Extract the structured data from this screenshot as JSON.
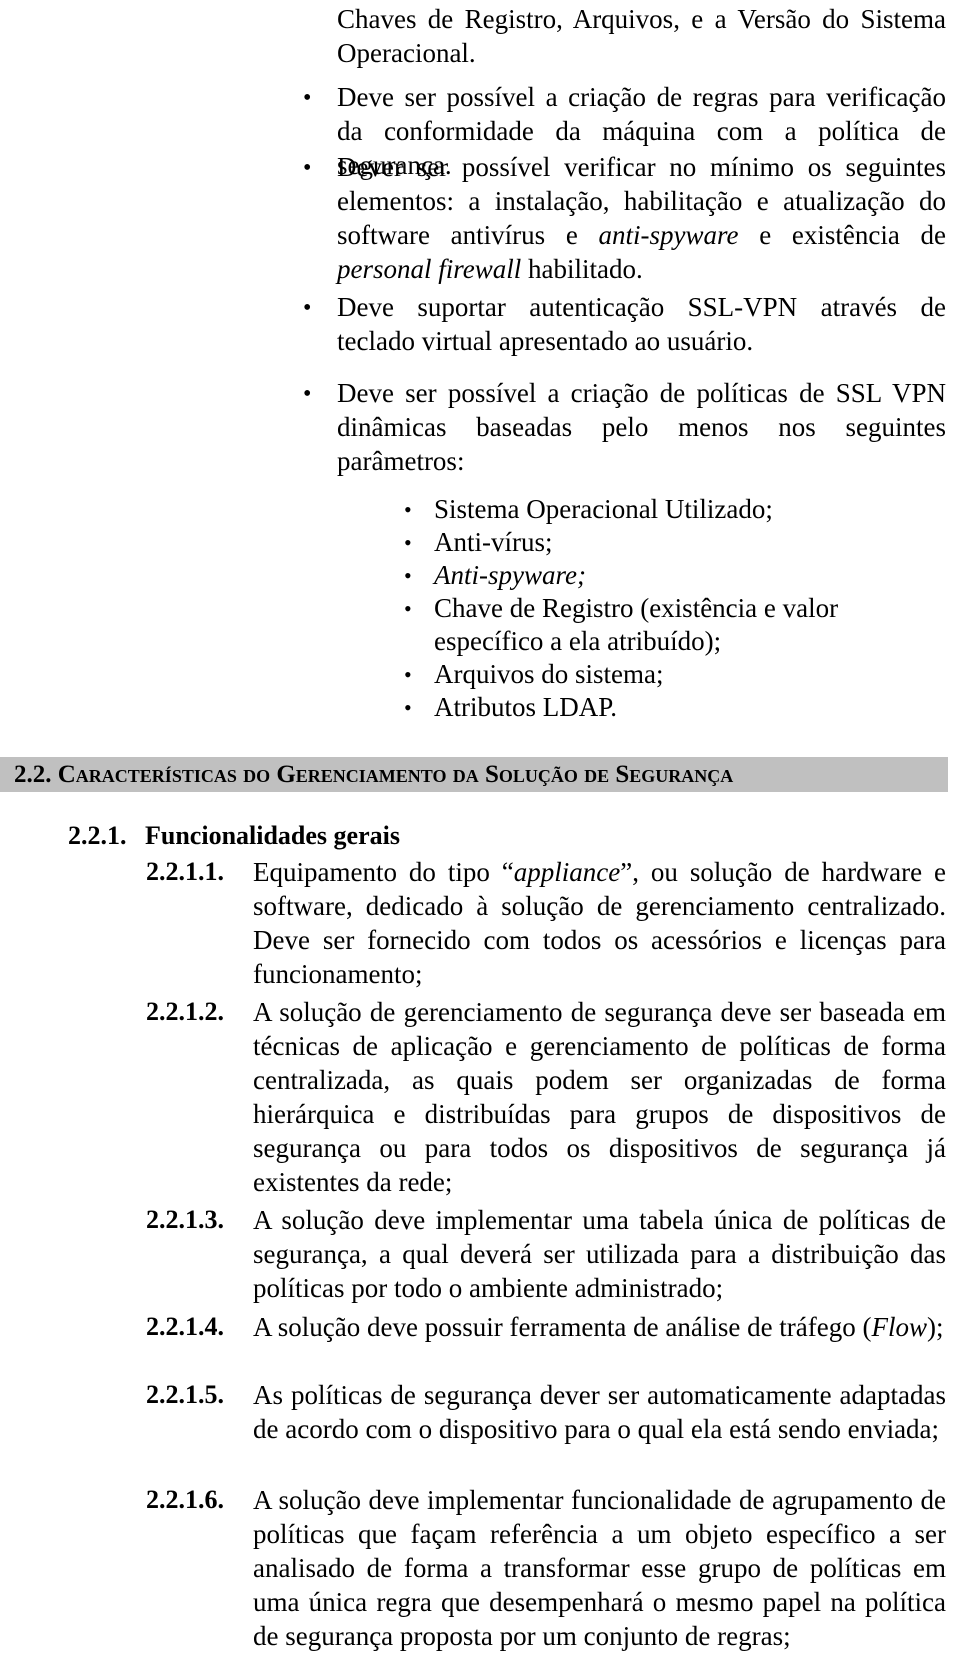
{
  "document": {
    "language": "pt-BR",
    "continuation_paragraph": {
      "text": "Chaves de Registro, Arquivos, e a Versão do Sistema Operacional."
    },
    "bullets_level1": [
      {
        "id": "bullet-regras-conformidade",
        "marker": "•",
        "text": "Deve ser possível a criação de regras para verificação da conformidade da máquina com a política de segurança."
      },
      {
        "id": "bullet-verificar-elementos",
        "marker": "•",
        "segments": [
          {
            "style": "normal",
            "text": "Dever ser possível verificar no mínimo os seguintes elementos: a instalação, habilitação e atualização do software antivírus e "
          },
          {
            "style": "italic",
            "text": "anti-spyware"
          },
          {
            "style": "normal",
            "text": " e existência de "
          },
          {
            "style": "italic",
            "text": "personal firewall"
          },
          {
            "style": "normal",
            "text": " habilitado."
          }
        ]
      },
      {
        "id": "bullet-sslvpn-teclado-virtual",
        "marker": "•",
        "text": "Deve suportar autenticação SSL-VPN através de teclado virtual apresentado ao usuário."
      },
      {
        "id": "bullet-politicas-sslvpn-dinamicas",
        "marker": "•",
        "text": "Deve ser possível a criação de políticas de SSL VPN dinâmicas baseadas pelo menos nos seguintes parâmetros:"
      }
    ],
    "bullets_level2": [
      {
        "id": "subbullet-sistema-operacional",
        "marker": "•",
        "style": "normal",
        "text": "Sistema Operacional Utilizado;"
      },
      {
        "id": "subbullet-anti-virus",
        "marker": "•",
        "style": "normal",
        "text": "Anti-vírus;"
      },
      {
        "id": "subbullet-anti-spyware",
        "marker": "•",
        "style": "italic",
        "text": "Anti-spyware;"
      },
      {
        "id": "subbullet-chave-registro",
        "marker": "•",
        "style": "normal",
        "text": "Chave de Registro (existência e valor específico a ela atribuído);"
      },
      {
        "id": "subbullet-arquivos-sistema",
        "marker": "•",
        "style": "normal",
        "text": "Arquivos do sistema;"
      },
      {
        "id": "subbullet-atributos-ldap",
        "marker": "•",
        "style": "normal",
        "text": "Atributos LDAP."
      }
    ],
    "heading_2_2": {
      "number": "2.2.",
      "title": "Características do Gerenciamento da Solução de Segurança",
      "background_color": "#c0c0c0"
    },
    "heading_2_2_1": {
      "number": "2.2.1.",
      "title": "Funcionalidades gerais"
    },
    "clauses": [
      {
        "id": "clause-2-2-1-1",
        "number": "2.2.1.1.",
        "segments": [
          {
            "style": "normal",
            "text": "Equipamento do tipo “"
          },
          {
            "style": "italic",
            "text": "appliance"
          },
          {
            "style": "normal",
            "text": "”, ou solução de hardware e software, dedicado à solução de gerenciamento centralizado. Deve ser fornecido com todos os acessórios e licenças para funcionamento;"
          }
        ]
      },
      {
        "id": "clause-2-2-1-2",
        "number": "2.2.1.2.",
        "segments": [
          {
            "style": "normal",
            "text": "A solução de gerenciamento de segurança deve ser baseada em técnicas de aplicação e gerenciamento de políticas de forma centralizada, as quais podem ser organizadas de forma hierárquica e distribuídas para grupos de dispositivos de segurança ou para todos os dispositivos de segurança já existentes da rede;"
          }
        ]
      },
      {
        "id": "clause-2-2-1-3",
        "number": "2.2.1.3.",
        "segments": [
          {
            "style": "normal",
            "text": "A solução deve implementar uma tabela única de políticas de segurança, a qual deverá ser utilizada para a distribuição das políticas por todo o ambiente administrado;"
          }
        ]
      },
      {
        "id": "clause-2-2-1-4",
        "number": "2.2.1.4.",
        "segments": [
          {
            "style": "normal",
            "text": "A solução deve possuir ferramenta de análise de tráfego ("
          },
          {
            "style": "italic",
            "text": "Flow"
          },
          {
            "style": "normal",
            "text": ");"
          }
        ]
      },
      {
        "id": "clause-2-2-1-5",
        "number": "2.2.1.5.",
        "segments": [
          {
            "style": "normal",
            "text": "As políticas de segurança dever ser automaticamente adaptadas de acordo com o dispositivo para o qual ela está sendo enviada;"
          }
        ]
      },
      {
        "id": "clause-2-2-1-6",
        "number": "2.2.1.6.",
        "segments": [
          {
            "style": "normal",
            "text": "A solução deve implementar funcionalidade de agrupamento de políticas que façam referência a um objeto específico a ser analisado de forma a transformar esse grupo de políticas em uma única regra que desempenhará o mesmo papel na política de segurança proposta por um conjunto de regras;"
          }
        ]
      }
    ]
  }
}
